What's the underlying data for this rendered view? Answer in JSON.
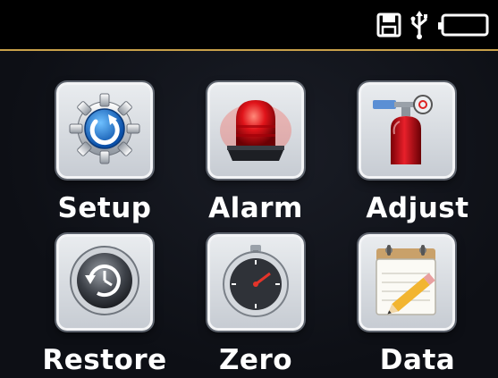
{
  "status": {
    "icons": [
      "save-icon",
      "usb-icon",
      "battery-icon"
    ],
    "accent_line_color": "#c9a14a"
  },
  "menu": {
    "items": [
      {
        "label": "Setup",
        "icon": "gear-icon"
      },
      {
        "label": "Alarm",
        "icon": "alarm-light-icon"
      },
      {
        "label": "Adjust",
        "icon": "gas-cylinder-icon"
      },
      {
        "label": "Restore",
        "icon": "restore-clock-icon"
      },
      {
        "label": "Zero",
        "icon": "stopwatch-icon"
      },
      {
        "label": "Data",
        "icon": "notepad-pencil-icon"
      }
    ]
  }
}
